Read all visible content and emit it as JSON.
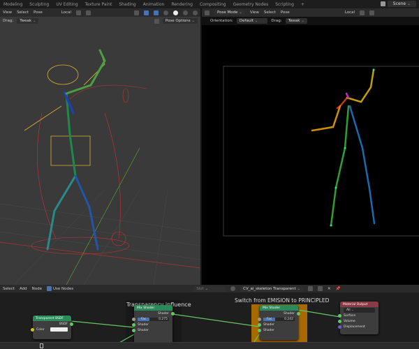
{
  "workspace_tabs": [
    "Modeling",
    "Sculpting",
    "UV Editing",
    "Texture Paint",
    "Shading",
    "Animation",
    "Rendering",
    "Compositing",
    "Geometry Nodes",
    "Scripting",
    "+"
  ],
  "scene": "Scene",
  "left_viewport": {
    "menu": [
      "View",
      "Select",
      "Pose"
    ],
    "transform": "Local",
    "drag_label": "Drag:",
    "drag": "Tweak",
    "pose_options": "Pose Options"
  },
  "right_viewport": {
    "mode": "Pose Mode",
    "menu": [
      "View",
      "Select",
      "Pose"
    ],
    "transform": "Local",
    "orientation_label": "Orientation:",
    "orientation": "Default",
    "drag_label": "Drag:",
    "drag": "Tweak"
  },
  "node_editor": {
    "menu": [
      "Select",
      "Add",
      "Node"
    ],
    "use_nodes": "Use Nodes",
    "slot": "Slot",
    "material": "CV_ai_skeleton Transparent",
    "frames": [
      "Transparency influence",
      "Switch from EMISION to PRINCIPLED"
    ],
    "transparent_bsdf": {
      "title": "Transparent BSDF",
      "out": "BSDF",
      "color": "Color"
    },
    "mix1": {
      "title": "Mix Shader",
      "out": "Shader",
      "fac_label": "Fac",
      "fac": "0.275",
      "in1": "Shader",
      "in2": "Shader"
    },
    "mix2": {
      "title": "Mix Shader",
      "out": "Shader",
      "fac_label": "Fac",
      "fac": "0.242",
      "in1": "Shader",
      "in2": "Shader"
    },
    "output": {
      "title": "Material Output",
      "target": "All",
      "surface": "Surface",
      "volume": "Volume",
      "displacement": "Displacement"
    }
  },
  "colors": {
    "accent": "#4772b3",
    "frame_orange": "#a66a00",
    "shader_header": "#2a8a5a",
    "output_header": "#8a3a45"
  }
}
